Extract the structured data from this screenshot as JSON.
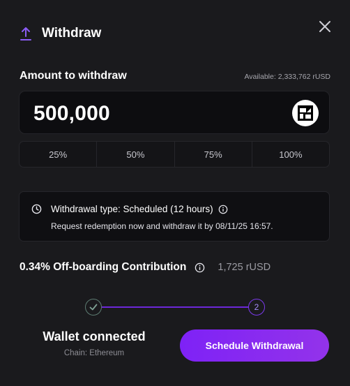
{
  "header": {
    "title": "Withdraw",
    "icon": "upload-arrow-icon",
    "accent": "#8b5cf6"
  },
  "close": {
    "icon": "close-icon"
  },
  "amount": {
    "label": "Amount to withdraw",
    "available": "Available: 2,333,762 rUSD",
    "value": "500,000",
    "token_icon": "token-logo-icon"
  },
  "percent_buttons": [
    "25%",
    "50%",
    "75%",
    "100%"
  ],
  "withdrawal_info": {
    "type_text": "Withdrawal type: Scheduled (12 hours)",
    "description": "Request redemption now and withdraw it by 08/11/25 16:57."
  },
  "contribution": {
    "label": "0.34% Off-boarding Contribution",
    "value": "1,725 rUSD"
  },
  "stepper": {
    "step2_label": "2",
    "step1_state": "completed"
  },
  "wallet": {
    "title": "Wallet connected",
    "chain": "Chain: Ethereum"
  },
  "action": {
    "label": "Schedule Withdrawal",
    "color": "#8b2cf5"
  }
}
